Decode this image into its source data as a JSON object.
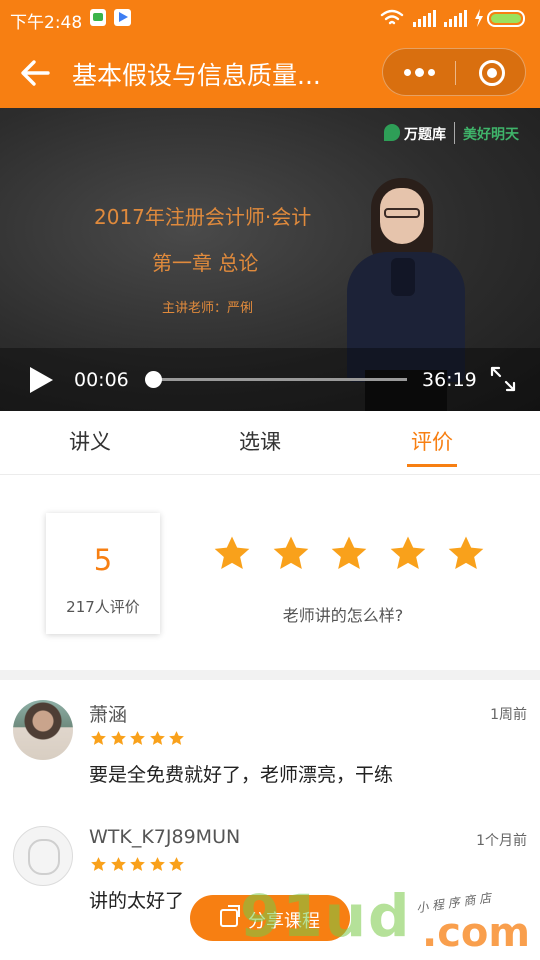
{
  "status_bar": {
    "time": "下午2:48"
  },
  "header": {
    "title": "基本假设与信息质量..."
  },
  "video": {
    "brand_name": "万题库",
    "brand_slogan": "美好明天",
    "lecture_title": "2017年注册会计师·会计",
    "lecture_chapter": "第一章 总论",
    "lecture_teacher": "主讲老师：严俐",
    "current_time": "00:06",
    "total_time": "36:19",
    "progress_fraction": 0.003
  },
  "tabs": [
    {
      "label": "讲义",
      "active": false
    },
    {
      "label": "选课",
      "active": false
    },
    {
      "label": "评价",
      "active": true
    }
  ],
  "rating": {
    "score": "5",
    "count_label": "217人评价",
    "stars_filled": 5,
    "prompt": "老师讲的怎么样?"
  },
  "comments": [
    {
      "user": "萧涵",
      "time": "1周前",
      "stars": 5,
      "text": "要是全免费就好了，老师漂亮，干练"
    },
    {
      "user": "WTK_K7J89MUN",
      "time": "1个月前",
      "stars": 5,
      "text": "讲的太好了"
    }
  ],
  "share_button": {
    "label": "分享课程"
  },
  "watermark": {
    "main": "91ud",
    "sub": ".com",
    "tag": "小 程 序 商 店"
  },
  "colors": {
    "accent": "#f77f12",
    "star": "#f9a11b"
  },
  "icons": {
    "back": "back-arrow-icon",
    "more": "more-dots-icon",
    "close": "close-target-icon",
    "play": "play-icon",
    "fullscreen": "fullscreen-icon",
    "star": "star-icon",
    "share": "share-icon"
  }
}
